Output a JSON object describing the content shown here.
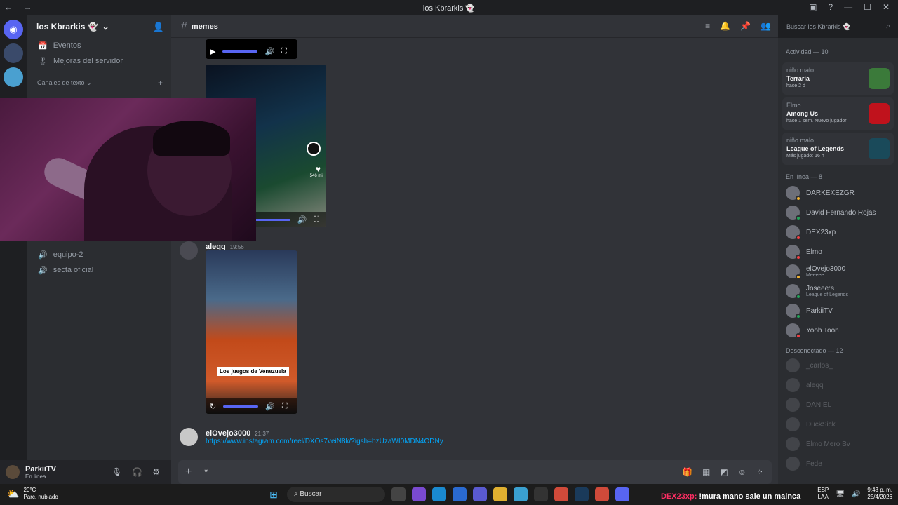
{
  "window": {
    "title": "los Kbrarkis 👻",
    "nav": "← →",
    "controls": [
      "—",
      "☐",
      "✕"
    ]
  },
  "guild": {
    "name": "los Kbrarkis 👻",
    "chevron": "⌄",
    "invite_icon": "👤"
  },
  "channel_list": {
    "items": [
      {
        "label": "Eventos",
        "icon": "📅"
      },
      {
        "label": "Mejoras del servidor",
        "icon": "🎖"
      }
    ],
    "category": "Canales de texto ⌄",
    "voice": [
      {
        "label": "equipo-2",
        "icon": "🔊"
      },
      {
        "label": "secta oficial",
        "icon": "🔊"
      }
    ]
  },
  "user_panel": {
    "name": "ParkiiTV",
    "status": "En línea"
  },
  "channel_header": {
    "name": "memes"
  },
  "messages": [
    {
      "user": "aleqq",
      "time": "19:56",
      "video_caption": "Los juegos de Venezuela"
    },
    {
      "user": "elOvejo3000",
      "time": "21:37",
      "link": "https://www.instagram.com/reel/DXOs7veiN8k/?igsh=bzUzaWI0MDN4ODNy"
    }
  ],
  "tiktok_likes": "546 mil",
  "composer": {
    "caret": "*"
  },
  "search": {
    "placeholder": "Buscar los Kbrarkis 👻"
  },
  "members_panel": {
    "activity_label": "Actividad — 10",
    "activities": [
      {
        "who": "niño malo",
        "game": "Terraria",
        "sub": "hace 2 d",
        "color": "#3b7a3a"
      },
      {
        "who": "Elmo",
        "game": "Among Us",
        "sub": "hace 1 sem.  Nuevo jugador",
        "color": "#c0121c"
      },
      {
        "who": "niño malo",
        "game": "League of Legends",
        "sub": "Más jugado: 16 h",
        "color": "#1a4a5a"
      }
    ],
    "online_label": "En línea — 8",
    "online": [
      {
        "name": "DARKEXEZGR",
        "sub": "",
        "status": "#f0b232"
      },
      {
        "name": "David Fernando Rojas",
        "sub": "",
        "status": "#23a55a"
      },
      {
        "name": "DEX23xp",
        "sub": "",
        "status": "#f23f43"
      },
      {
        "name": "Elmo",
        "sub": "",
        "status": "#f23f43"
      },
      {
        "name": "elOvejo3000",
        "sub": "Meeeee",
        "status": "#f0b232"
      },
      {
        "name": "Joseee:s",
        "sub": "League of Legends",
        "status": "#23a55a"
      },
      {
        "name": "ParkiiTV",
        "sub": "",
        "status": "#23a55a"
      },
      {
        "name": "Yoob Toon",
        "sub": "",
        "status": "#f23f43"
      }
    ],
    "offline_label": "Desconectado — 12",
    "offline": [
      "_carlos_",
      "aleqq",
      "DANIEL",
      "DuckSick",
      "Elmo Mero Bv",
      "Fede"
    ]
  },
  "taskbar": {
    "temp": "20°C",
    "weather": "Parc. nublado",
    "search": "Buscar",
    "lang": "ESP\nLAA",
    "time": "9:43 p. m.",
    "date": "25/4/2026"
  },
  "stream_overlay": {
    "user": "DEX23xp:",
    "message": " !mura mano sale un mainca"
  }
}
